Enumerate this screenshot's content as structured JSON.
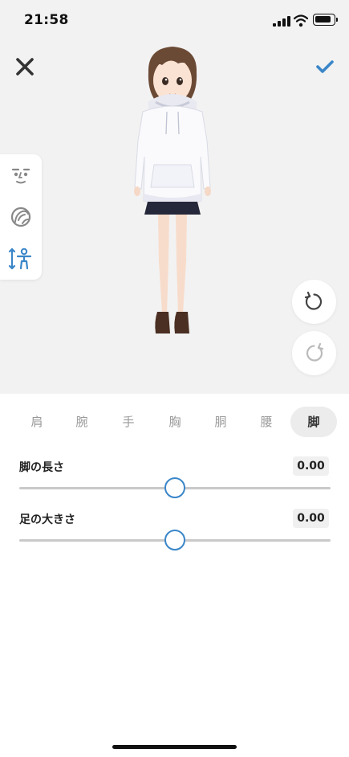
{
  "status_bar": {
    "time": "21:58"
  },
  "toolbar": {
    "close_icon": "close-icon",
    "confirm_icon": "checkmark-icon"
  },
  "side_panel": {
    "items": [
      {
        "name": "face-icon"
      },
      {
        "name": "hair-icon"
      },
      {
        "name": "body-icon",
        "active": true
      }
    ]
  },
  "controls": {
    "undo_icon": "undo-icon",
    "redo_icon": "redo-icon"
  },
  "tabs": [
    {
      "label": "肩"
    },
    {
      "label": "腕"
    },
    {
      "label": "手"
    },
    {
      "label": "胸"
    },
    {
      "label": "胴"
    },
    {
      "label": "腰"
    },
    {
      "label": "脚",
      "active": true
    }
  ],
  "sliders": [
    {
      "label": "脚の長さ",
      "value": "0.00",
      "position": 0.5
    },
    {
      "label": "足の大きさ",
      "value": "0.00",
      "position": 0.5
    }
  ],
  "colors": {
    "accent": "#3a86c8",
    "preview_bg": "#f2f2f2",
    "inactive_icon": "#888888"
  }
}
